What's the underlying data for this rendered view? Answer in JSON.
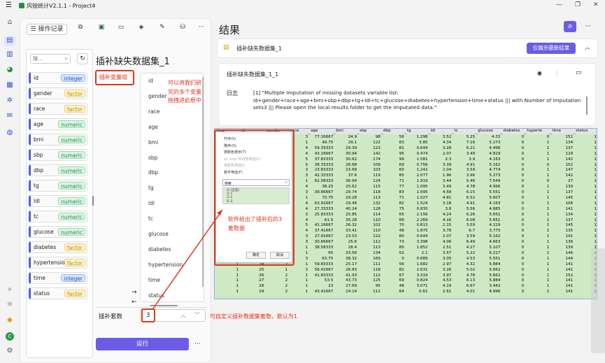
{
  "app": {
    "title": "风锐统计V2.1.1 - Project4"
  },
  "toolbar": {
    "history_label": "操作记录",
    "more": "···"
  },
  "search": {
    "placeholder": "搜..."
  },
  "variables": [
    {
      "name": "id",
      "type": "integer"
    },
    {
      "name": "gender",
      "type": "factor"
    },
    {
      "name": "race",
      "type": "factor"
    },
    {
      "name": "age",
      "type": "numeric"
    },
    {
      "name": "bmi",
      "type": "numeric"
    },
    {
      "name": "sbp",
      "type": "numeric"
    },
    {
      "name": "dbp",
      "type": "numeric"
    },
    {
      "name": "tg",
      "type": "numeric"
    },
    {
      "name": "ldl",
      "type": "numeric"
    },
    {
      "name": "tc",
      "type": "numeric"
    },
    {
      "name": "glucose",
      "type": "numeric"
    },
    {
      "name": "diabetes",
      "type": "factor"
    },
    {
      "name": "hypertension",
      "type": "factor"
    },
    {
      "name": "time",
      "type": "integer"
    },
    {
      "name": "status",
      "type": "factor"
    }
  ],
  "panel": {
    "title": "插补缺失数据集_1",
    "var_group_label": "插补变量组",
    "selected": [
      "id",
      "gender",
      "race",
      "age",
      "bmi",
      "sbp",
      "dbp",
      "tg",
      "ldl",
      "tc",
      "glucose",
      "diabetes",
      "hypertension",
      "time",
      "status"
    ],
    "sets_label": "插补套数",
    "sets_value": "3",
    "run_label": "运行",
    "more": "···"
  },
  "annotations": {
    "drag_note": "可以将我们研究的多个变量拖拽进此框中",
    "sets_note": "可自定义插补数据集套数，默认为1",
    "result_note": "软件给出了插补后的3套数据"
  },
  "result": {
    "heading": "结果",
    "tab_title": "插补缺失数据集_1",
    "latest_only": "仅展示最新结果",
    "card_title": "插补缺失数据集_1_1",
    "log_label": "日志",
    "log_text": "[1] \"Multiple Imputation of missing datasets variable list: id+gender+race+age+bmi+sbp+dbp+tg+ldl+tc+glucose+diabetes+hypertension+time+status ||| with Number of imputation sets3 ||| Please open the local results folder to get the imputated data.\""
  },
  "grid": {
    "headers": [
      ".imp",
      "id",
      "gender",
      "race",
      "age",
      "bmi",
      "sbp",
      "dbp",
      "tg",
      "ldl",
      "tc",
      "glucose",
      "diabetes",
      "hyperte",
      "time",
      "status"
    ],
    "rows": [
      [
        "1",
        "1",
        "1",
        "3",
        "77.16667",
        "24.9",
        "98",
        "56",
        "1.298",
        "3.52",
        "5.25",
        "4.33",
        "0",
        "0",
        "151",
        "1"
      ],
      [
        "1",
        "2",
        "1",
        "1",
        "49.75",
        "29.1",
        "122",
        "83",
        "3.85",
        "4.34",
        "7.16",
        "5.273",
        "0",
        "1",
        "134",
        "1"
      ],
      [
        "1",
        "3",
        "2",
        "4",
        "59.33333",
        "29.39",
        "123",
        "81",
        "0.644",
        "3.28",
        "6.21",
        "4.496",
        "0",
        "1",
        "137",
        "1"
      ],
      [
        "1",
        "4",
        "2",
        "4",
        "43.16667",
        "30.94",
        "142",
        "95",
        "0.474",
        "2.07",
        "3.49",
        "4.829",
        "0",
        "1",
        "129",
        "1"
      ],
      [
        "1",
        "5",
        "1",
        "5",
        "37.83333",
        "30.62",
        "174",
        "99",
        "1.581",
        "2.3",
        "3.9",
        "4.163",
        "0",
        "1",
        "142",
        "1"
      ],
      [
        "1",
        "6",
        "2",
        "5",
        "38.33333",
        "26.68",
        "109",
        "69",
        "0.756",
        "3.39",
        "4.91",
        "5.162",
        "0",
        "0",
        "152",
        "1"
      ],
      [
        "1",
        "7",
        "2",
        "3",
        "23.83333",
        "23.68",
        "103",
        "60",
        "1.242",
        "2.04",
        "3.59",
        "4.774",
        "0",
        "1",
        "147",
        "1"
      ],
      [
        "1",
        "8",
        "2",
        "3",
        "42.33333",
        "37.6",
        "119",
        "85",
        "2.077",
        "1.96",
        "3.96",
        "5.273",
        "0",
        "1",
        "142",
        "1"
      ],
      [
        "1",
        "9",
        "2",
        "1",
        "62.08333",
        "36.94",
        "124",
        "71",
        "1.919",
        "3.44",
        "5.46",
        "7.549",
        "0",
        "0",
        "27",
        "1"
      ],
      [
        "1",
        "10",
        "2",
        "4",
        "38.25",
        "25.62",
        "115",
        "77",
        "1.095",
        "3.49",
        "4.78",
        "4.996",
        "0",
        "1",
        "139",
        "1"
      ],
      [
        "1",
        "11",
        "2",
        "3",
        "39.66667",
        "29.74",
        "118",
        "83",
        "1.095",
        "4.58",
        "6.15",
        "5.551",
        "0",
        "1",
        "137",
        "1"
      ],
      [
        "1",
        "12",
        "1",
        "1",
        "70.75",
        "29.28",
        "113",
        "71",
        "1.027",
        "4.81",
        "6.52",
        "5.607",
        "0",
        "1",
        "145",
        "1"
      ],
      [
        "1",
        "13",
        "2",
        "4",
        "63.91667",
        "29.48",
        "132",
        "82",
        "1.524",
        "3.18",
        "4.91",
        "4.163",
        "0",
        "1",
        "106",
        "1"
      ],
      [
        "1",
        "14",
        "2",
        "4",
        "27.33333",
        "40.24",
        "128",
        "75",
        "0.835",
        "3.8",
        "5.56",
        "4.885",
        "0",
        "1",
        "141",
        "1"
      ],
      [
        "1",
        "15",
        "2",
        "3",
        "25.83333",
        "25.85",
        "114",
        "65",
        "2.156",
        "4.24",
        "6.26",
        "5.651",
        "0",
        "1",
        "134",
        "1"
      ],
      [
        "1",
        "16",
        "2",
        "4",
        "61.5",
        "35.28",
        "110",
        "66",
        "2.269",
        "4.16",
        "6.08",
        "5.651",
        "0",
        "1",
        "137",
        "1"
      ],
      [
        "1",
        "17",
        "2",
        "5",
        "41.16667",
        "26.32",
        "102",
        "70",
        "0.813",
        "2.15",
        "3.59",
        "4.219",
        "0",
        "1",
        "145",
        "1"
      ],
      [
        "1",
        "18",
        "2",
        "4",
        "37.41667",
        "33.41",
        "110",
        "48",
        "1.875",
        "3.78",
        "6.7",
        "3.775",
        "0",
        "1",
        "135",
        "1"
      ],
      [
        "1",
        "19",
        "1",
        "3",
        "27.91667",
        "23.53",
        "122",
        "80",
        "0.644",
        "2.07",
        "3.59",
        "5.162",
        "0",
        "1",
        "141",
        "1"
      ],
      [
        "1",
        "20",
        "2",
        "3",
        "30.66667",
        "25.6",
        "112",
        "73",
        "3.398",
        "4.06",
        "6.49",
        "4.663",
        "0",
        "1",
        "136",
        "1"
      ],
      [
        "1",
        "21",
        "2",
        "1",
        "38.58333",
        "28.4",
        "113",
        "80",
        "1.852",
        "2.51",
        "4.27",
        "5.107",
        "0",
        "1",
        "139",
        "1"
      ],
      [
        "1",
        "22",
        "2",
        "1",
        "65",
        "33.56",
        "134",
        "52",
        "2.1",
        "3.57",
        "5.22",
        "6.217",
        "0",
        "1",
        "146",
        "1"
      ],
      [
        "1",
        "23",
        "2",
        "3",
        "63.75",
        "38.32",
        "169",
        "0",
        "0.689",
        "3.05",
        "4.53",
        "5.551",
        "0",
        "1",
        "144",
        "1"
      ],
      [
        "1",
        "24",
        "2",
        "1",
        "59.83333",
        "25.17",
        "111",
        "56",
        "1.682",
        "2.97",
        "4.32",
        "5.884",
        "0",
        "1",
        "141",
        "1"
      ],
      [
        "1",
        "25",
        "1",
        "3",
        "56.41667",
        "26.83",
        "118",
        "82",
        "2.631",
        "3.26",
        "5.02",
        "5.662",
        "0",
        "1",
        "141",
        "1"
      ],
      [
        "1",
        "26",
        "2",
        "1",
        "41.83333",
        "41.93",
        "112",
        "67",
        "3.319",
        "3.97",
        "4.78",
        "5.662",
        "0",
        "1",
        "152",
        "1"
      ],
      [
        "1",
        "27",
        "2",
        "1",
        "53.5",
        "43.73",
        "125",
        "69",
        "0.824",
        "4.53",
        "6.13",
        "5.884",
        "0",
        "1",
        "141",
        "1"
      ],
      [
        "1",
        "28",
        "2",
        "1",
        "23",
        "27.69",
        "95",
        "48",
        "3.071",
        "4.19",
        "6.67",
        "3.442",
        "0",
        "1",
        "141",
        "1"
      ],
      [
        "1",
        "29",
        "2",
        "1",
        "43.41667",
        "24.14",
        "112",
        "64",
        "0.61",
        "2.61",
        "4.01",
        "4.996",
        "0",
        "1",
        "141",
        "1"
      ]
    ]
  },
  "ctx_menu": {
    "items": [
      "升序(S)",
      "降序(O)",
      "按颜色排序(T)",
      "从\".imp\"中清除筛选(C)",
      "按颜色筛选(I)",
      "数字筛选(F)"
    ],
    "search": "搜索",
    "checks": [
      "(全选)",
      "1",
      "2",
      "3"
    ],
    "ok": "确定",
    "cancel": "取消"
  }
}
